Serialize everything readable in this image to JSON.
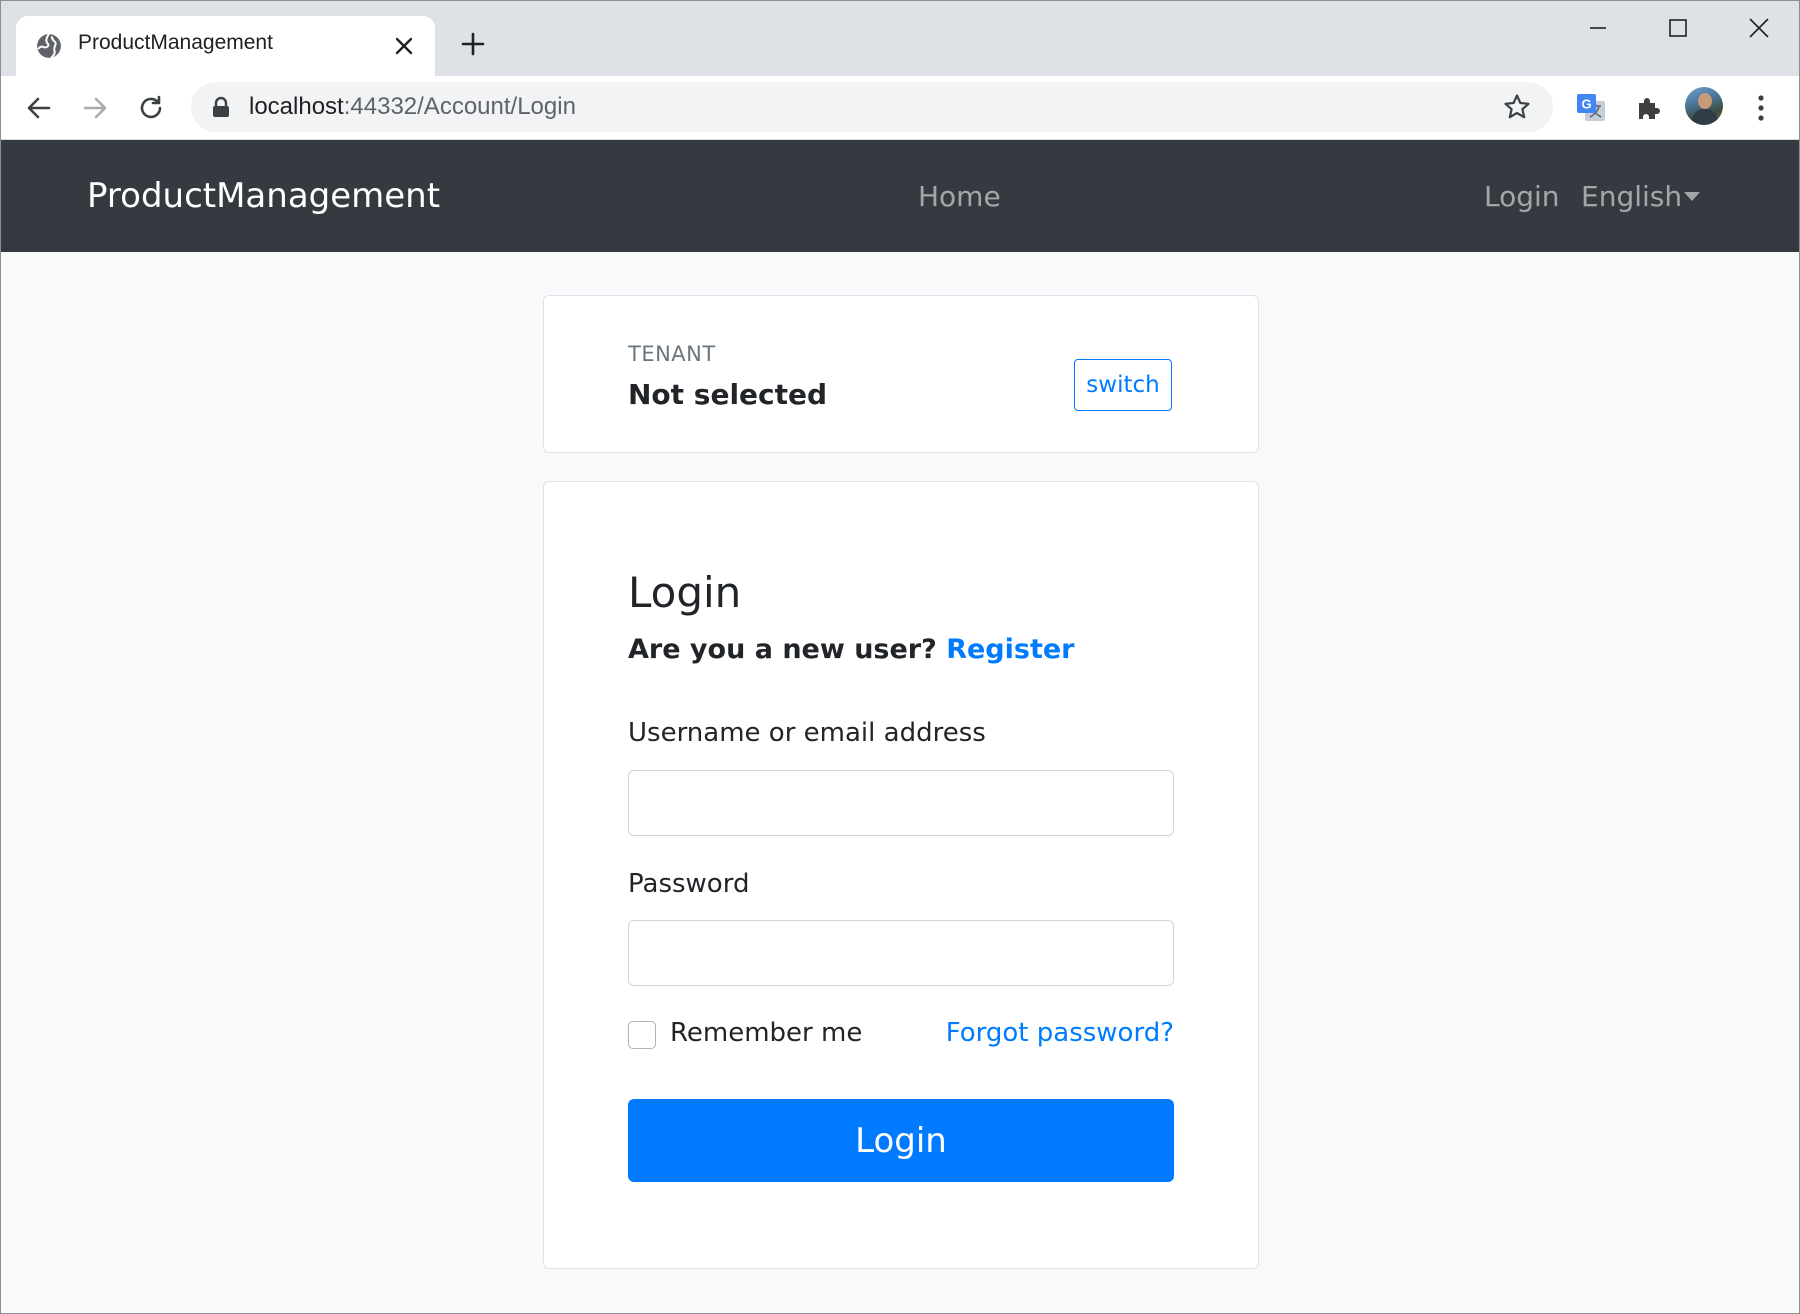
{
  "browser": {
    "tab_title": "ProductManagement",
    "url_host": "localhost",
    "url_rest": ":44332/Account/Login"
  },
  "navbar": {
    "brand": "ProductManagement",
    "home": "Home",
    "login": "Login",
    "language": "English"
  },
  "tenant": {
    "label": "TENANT",
    "value": "Not selected",
    "switch_label": "switch"
  },
  "login_form": {
    "title": "Login",
    "new_user_prompt": "Are you a new user?",
    "register_label": "Register",
    "username_label": "Username or email address",
    "username_value": "",
    "password_label": "Password",
    "password_value": "",
    "remember_label": "Remember me",
    "remember_checked": false,
    "forgot_label": "Forgot password?",
    "submit_label": "Login"
  },
  "colors": {
    "navbar_bg": "#343a40",
    "primary": "#007bff",
    "page_bg": "#f8f9fa"
  }
}
